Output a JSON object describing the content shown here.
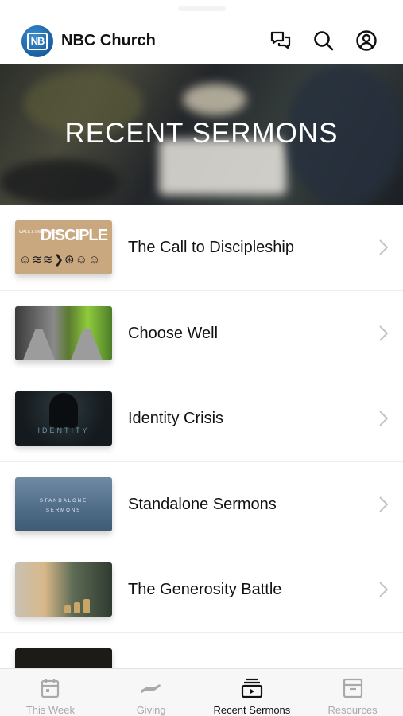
{
  "app": {
    "logo_text": "NB",
    "title": "NBC Church",
    "icons": [
      "chat-icon",
      "search-icon",
      "account-icon"
    ]
  },
  "hero": {
    "title": "RECENT SERMONS"
  },
  "sermons": [
    {
      "title": "The Call to Discipleship",
      "thumb_text": "DISCIPLE",
      "thumb_small": "WALK & DISCIPLESHIP"
    },
    {
      "title": "Choose Well"
    },
    {
      "title": "Identity Crisis",
      "thumb_text": "IDENTITY"
    },
    {
      "title": "Standalone Sermons",
      "thumb_text": "STANDALONE",
      "thumb_text2": "SERMONS"
    },
    {
      "title": "The Generosity Battle"
    },
    {
      "title": ""
    }
  ],
  "tabs": [
    {
      "label": "This Week",
      "icon": "calendar-icon",
      "active": false
    },
    {
      "label": "Giving",
      "icon": "giving-hand-icon",
      "active": false
    },
    {
      "label": "Recent Sermons",
      "icon": "video-playlist-icon",
      "active": true
    },
    {
      "label": "Resources",
      "icon": "archive-box-icon",
      "active": false
    }
  ],
  "colors": {
    "accent": "#1d64a6",
    "text": "#111111",
    "inactive_tab": "#a9a9a9",
    "tabbar_bg": "#f7f7f7"
  }
}
